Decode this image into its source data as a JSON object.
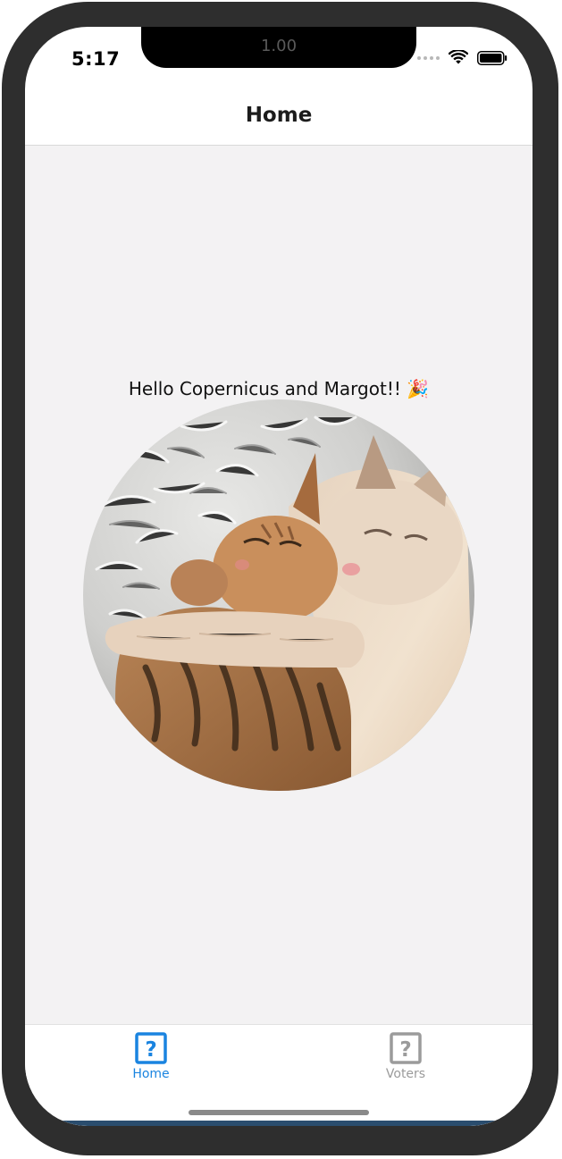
{
  "status_bar": {
    "time": "5:17",
    "notch_label": "1.00",
    "icons": [
      "signal-dots-icon",
      "wifi-icon",
      "battery-icon"
    ]
  },
  "navbar": {
    "title": "Home"
  },
  "main": {
    "greeting": "Hello Copernicus and Margot!! 🎉",
    "photo": "two cats cuddling on a fluffy white blanket"
  },
  "tabbar": {
    "tabs": [
      {
        "label": "Home",
        "icon": "question-box-icon",
        "active": true,
        "color": "#1a84e0"
      },
      {
        "label": "Voters",
        "icon": "question-box-icon",
        "active": false,
        "color": "#9b9b9b"
      }
    ]
  },
  "colors": {
    "frame": "#2e2e2e",
    "content_bg": "#f3f2f3",
    "accent": "#1a84e0",
    "inactive": "#9b9b9b"
  }
}
